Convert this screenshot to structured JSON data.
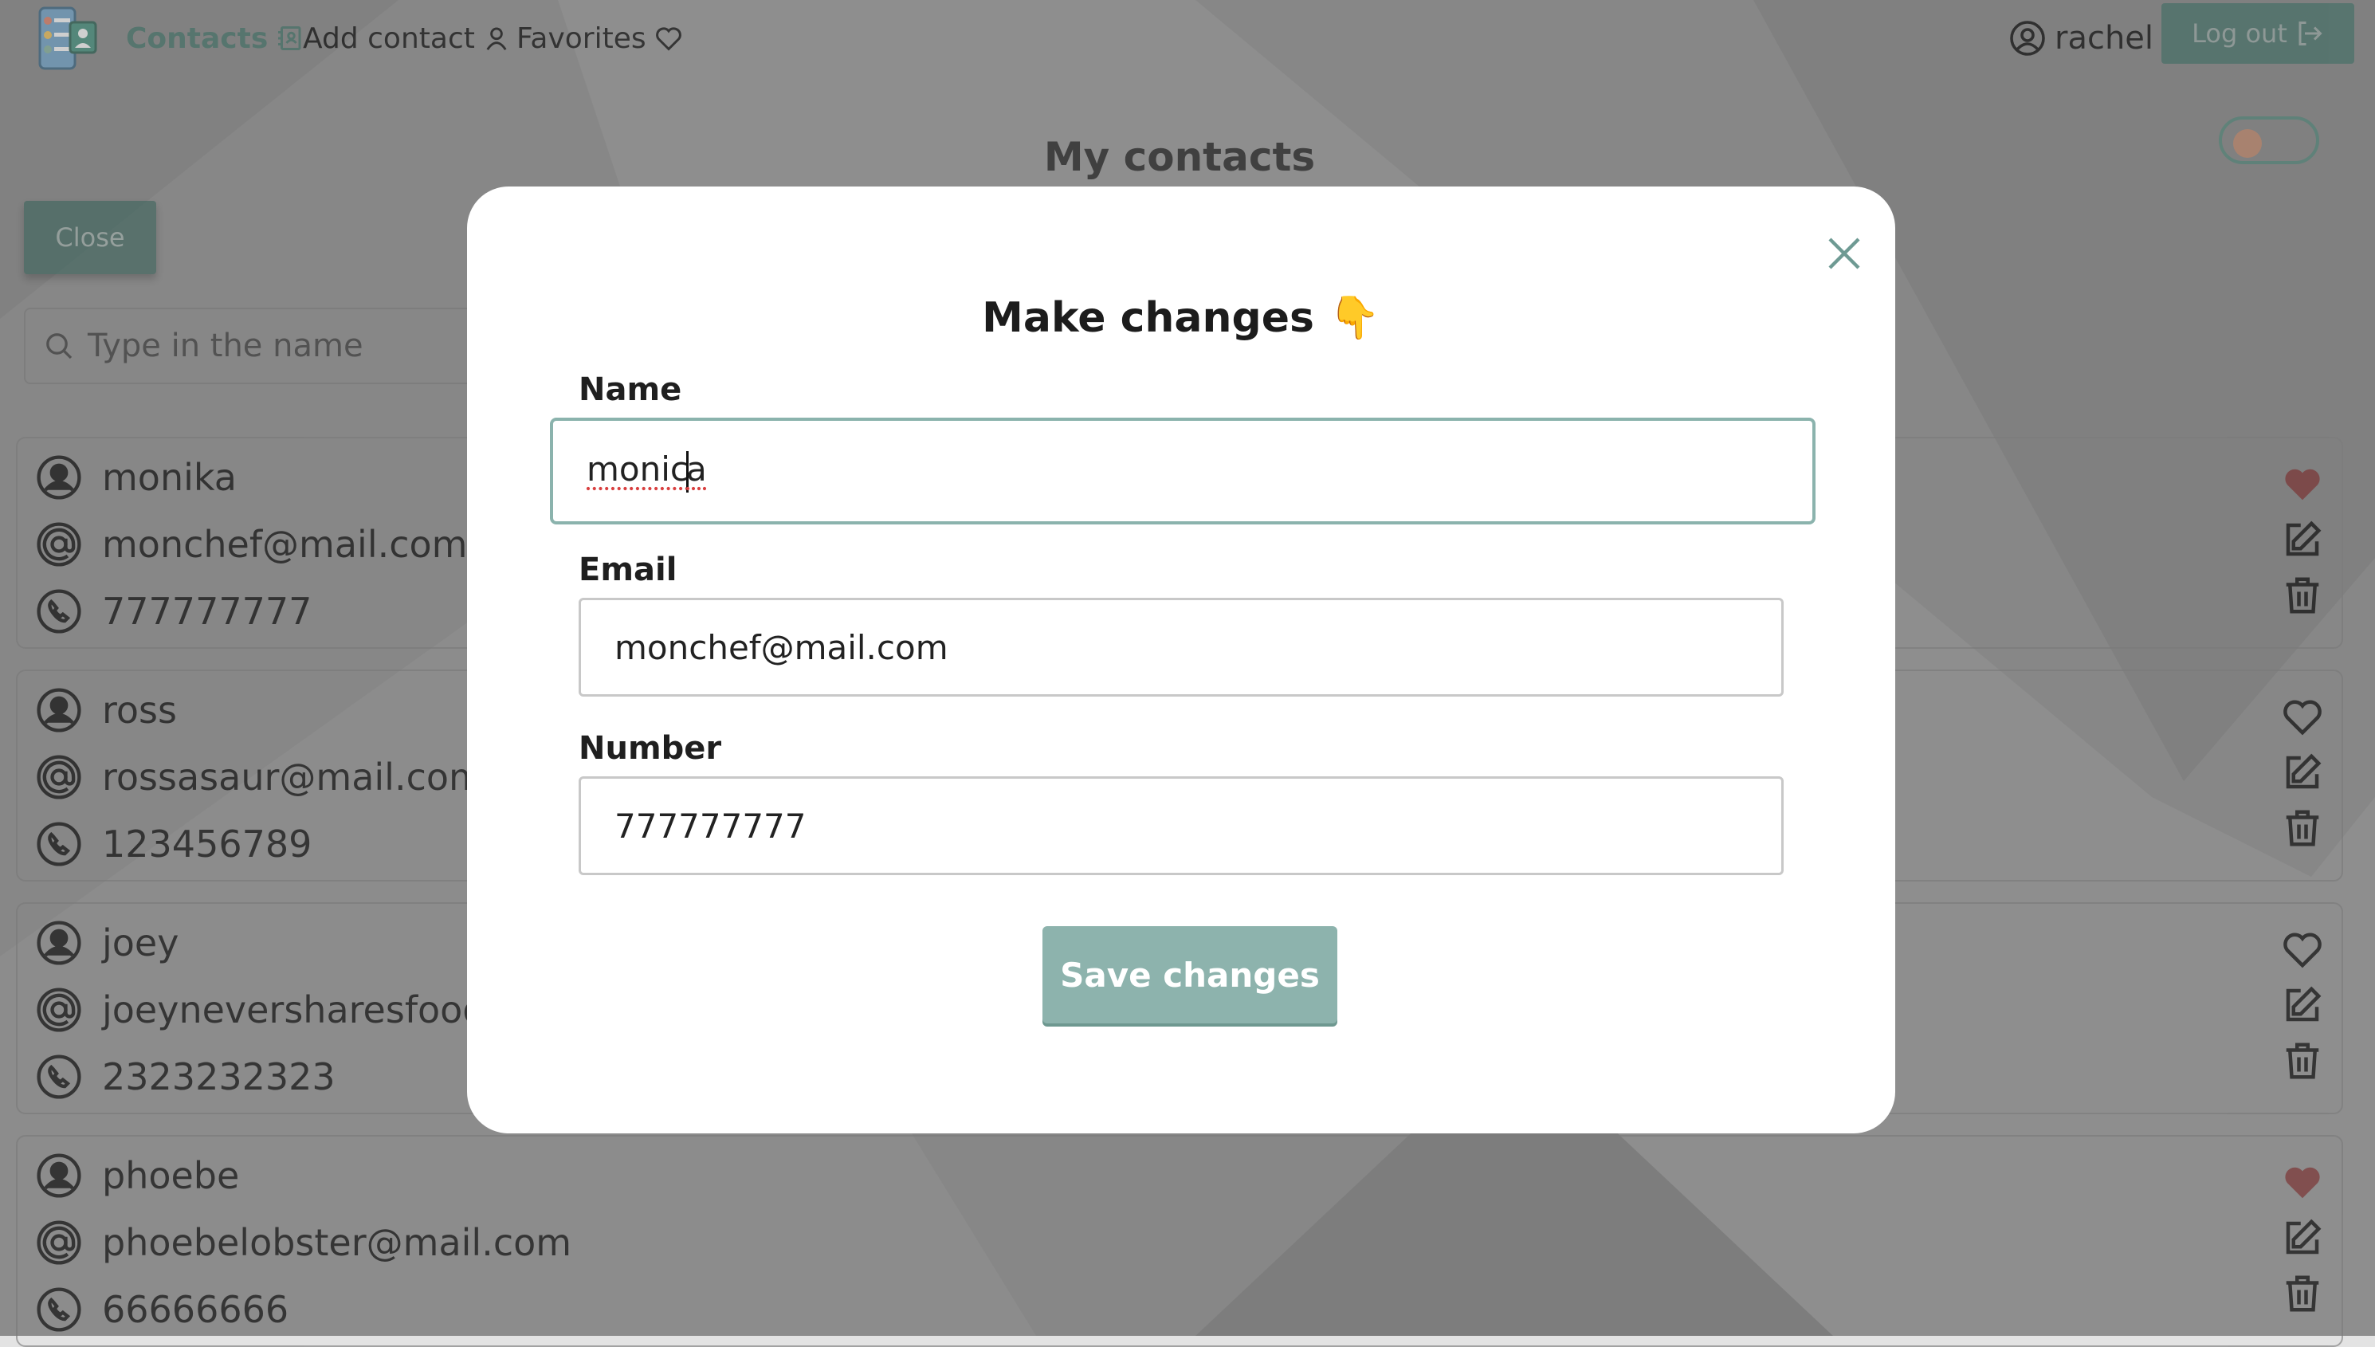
{
  "nav": {
    "contacts": "Contacts",
    "add_contact": "Add contact",
    "favorites": "Favorites"
  },
  "user": {
    "name": "rachel",
    "logout": "Log out"
  },
  "page": {
    "title": "My contacts",
    "close_label": "Close",
    "search_placeholder": "Type in the name"
  },
  "contacts": [
    {
      "name": "monika",
      "email": "monchef@mail.com",
      "phone": "777777777",
      "favorite": true
    },
    {
      "name": "ross",
      "email": "rossasaur@mail.com",
      "phone": "123456789",
      "favorite": false
    },
    {
      "name": "joey",
      "email": "joeyneversharesfood@",
      "phone": "2323232323",
      "favorite": false
    },
    {
      "name": "phoebe",
      "email": "phoebelobster@mail.com",
      "phone": "66666666",
      "favorite": true
    }
  ],
  "modal": {
    "title": "Make changes",
    "emoji": "👇",
    "name_label": "Name",
    "name_value_before_caret": "monic",
    "name_value_after_caret": "a",
    "email_label": "Email",
    "email_value": "monchef@mail.com",
    "number_label": "Number",
    "number_value": "777777777",
    "save_label": "Save changes"
  },
  "colors": {
    "accent": "#8db3ad",
    "brand_dark": "#3f6d64",
    "favorite": "#7a2a2a"
  }
}
